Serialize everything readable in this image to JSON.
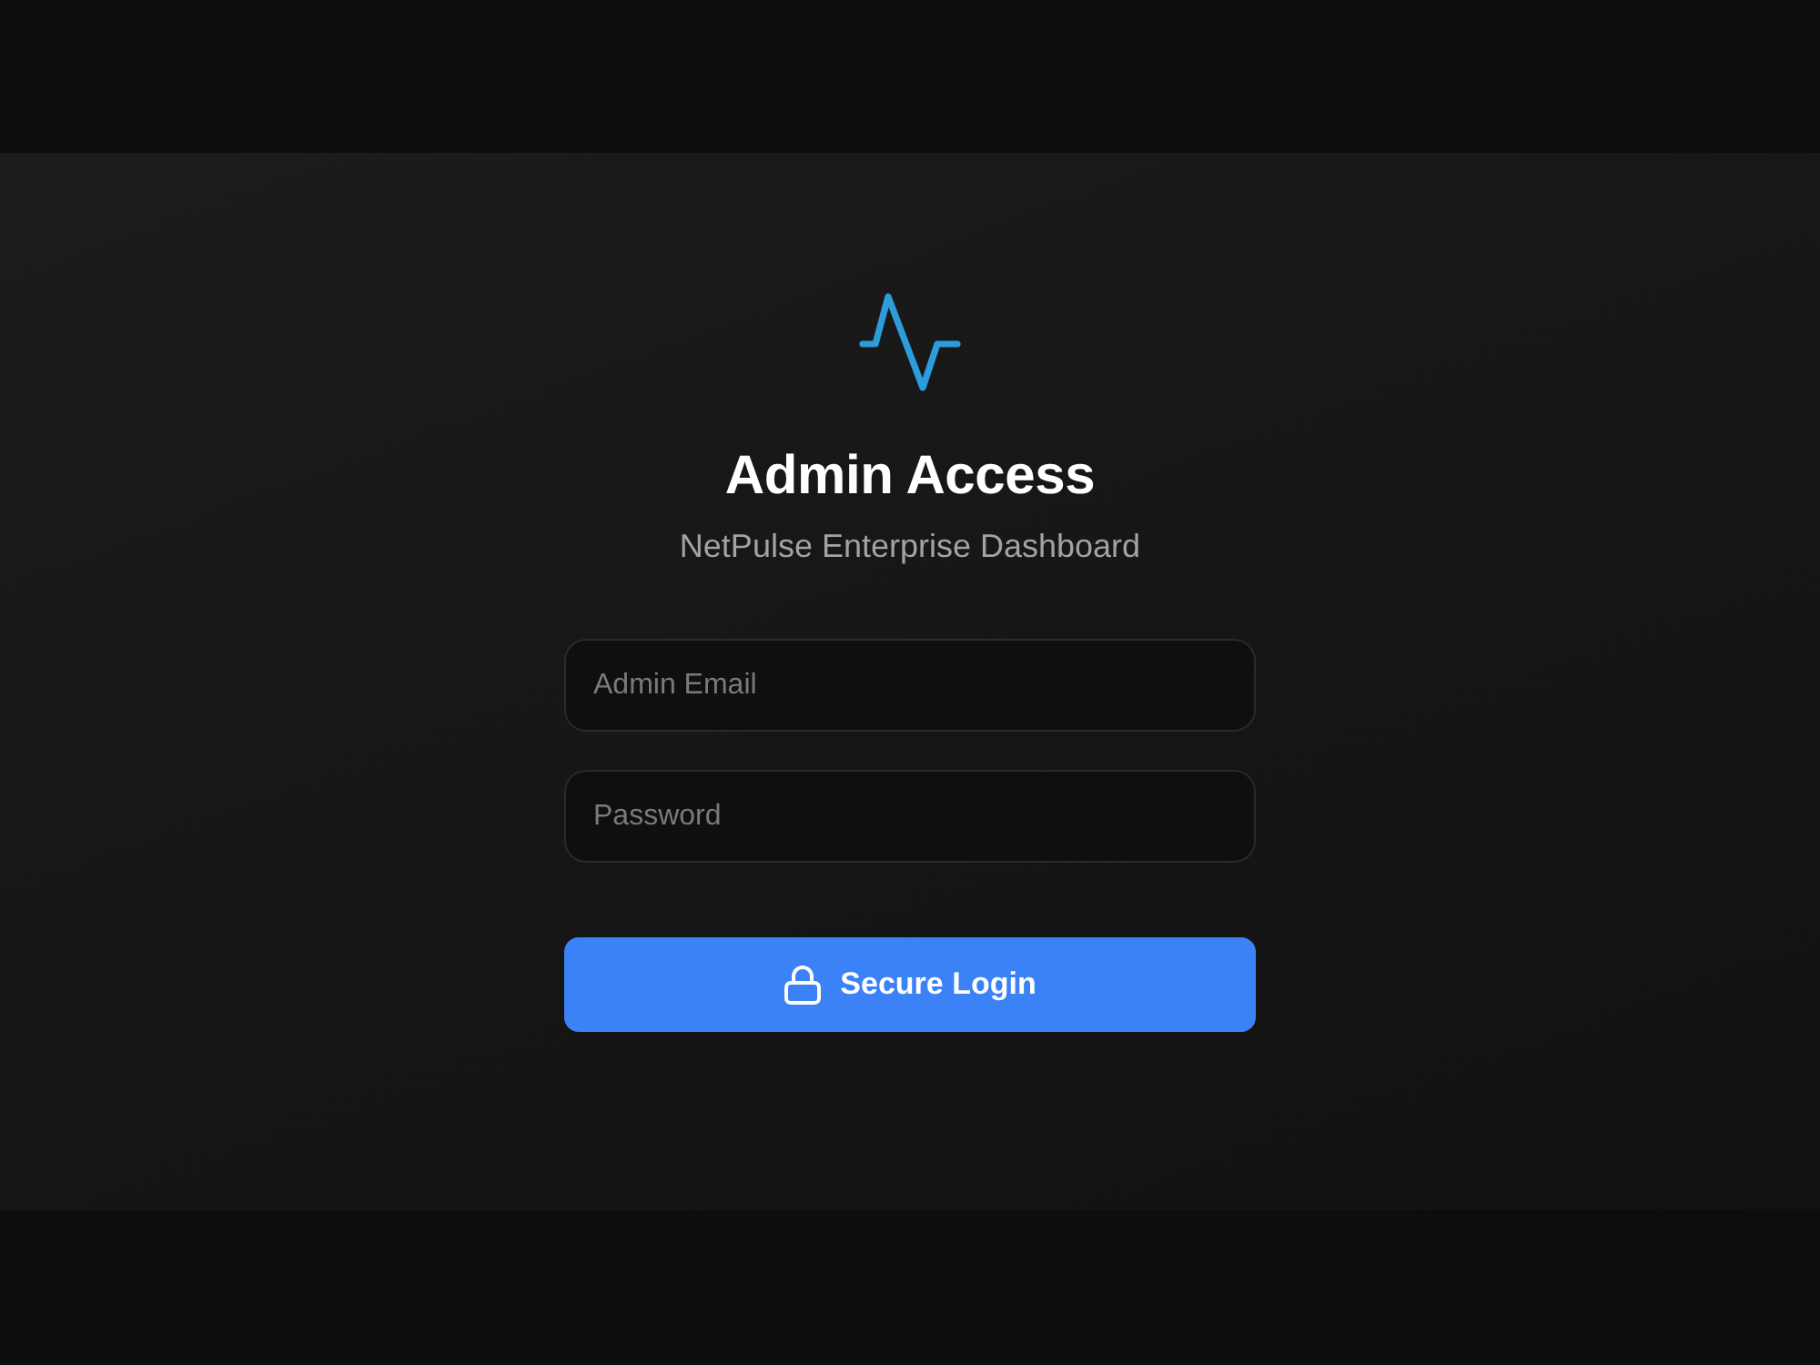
{
  "title": "Admin Access",
  "subtitle": "NetPulse Enterprise Dashboard",
  "fields": [
    {
      "placeholder": "Admin Email"
    },
    {
      "placeholder": "Password"
    }
  ],
  "submit_button": {
    "label": "Secure Login"
  }
}
